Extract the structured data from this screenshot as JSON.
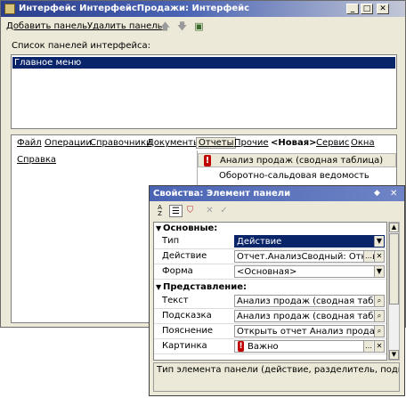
{
  "main_window": {
    "title": "Интерфейс ИнтерфейсПродажи: Интерфейс",
    "toolbar": {
      "add_panel": "Добавить панель",
      "delete_panel": "Удалить панель"
    },
    "panels_label": "Список панелей интерфейса:",
    "panels": [
      "Главное меню"
    ],
    "menu": [
      "Файл",
      "Операции",
      "Справочники",
      "Документы",
      "Отчеты",
      "Прочие",
      "<Новая>",
      "Сервис",
      "Окна"
    ],
    "menu_second_row": "Справка",
    "dropdown_items": [
      "Анализ продаж (сводная таблица)",
      "Оборотно-сальдовая ведомость"
    ]
  },
  "properties_window": {
    "title": "Свойства: Элемент панели",
    "sections": {
      "main": "Основные:",
      "presentation": "Представление:"
    },
    "rows": [
      {
        "label": "Тип",
        "value": "Действие"
      },
      {
        "label": "Действие",
        "value": "Отчет.АнализСводный: Открыть отчет"
      },
      {
        "label": "Форма",
        "value": "<Основная>"
      },
      {
        "label": "Текст",
        "value": "Анализ продаж (сводная таблица)"
      },
      {
        "label": "Подсказка",
        "value": "Анализ продаж (сводная таблица)"
      },
      {
        "label": "Пояснение",
        "value": "Открыть отчет Анализ продаж (сво"
      },
      {
        "label": "Картинка",
        "value": "Важно"
      }
    ],
    "description": "Тип элемента панели (действие, разделитель, подменю)"
  }
}
